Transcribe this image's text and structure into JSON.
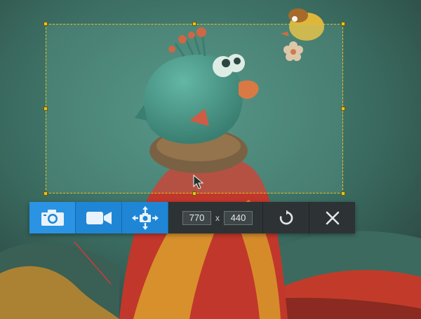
{
  "toolbar": {
    "buttons": [
      {
        "name": "screenshot",
        "icon": "camera-icon"
      },
      {
        "name": "record-video",
        "icon": "video-camera-icon"
      },
      {
        "name": "move-capture",
        "icon": "move-arrows-icon"
      }
    ],
    "width_value": "770",
    "times_symbol": "x",
    "height_value": "440",
    "redo_icon": "redo-icon",
    "close_icon": "close-icon"
  },
  "colors": {
    "selection_border": "#e8c21a",
    "toolbar_blue": "#1f86d6",
    "toolbar_dark": "#2d3334",
    "background": "#2f4e46"
  }
}
